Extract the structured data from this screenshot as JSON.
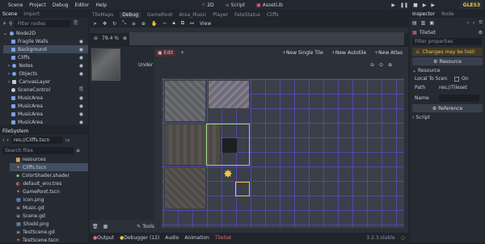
{
  "menu": [
    "Scene",
    "Project",
    "Debug",
    "Editor",
    "Help"
  ],
  "workspaces": [
    "2D",
    "Script",
    "AssetLib"
  ],
  "renderer": "GLES3",
  "scene_panel": {
    "tabs": [
      "Scene",
      "Import"
    ],
    "filter_placeholder": "Filter nodes",
    "nodes": [
      "Node2D",
      "Fragile Walls",
      "Background",
      "Cliffs",
      "Notes",
      "Objects",
      "CanvasLayer",
      "SceneControl",
      "MusicArea",
      "MusicArea",
      "MusicArea",
      "MusicArea"
    ]
  },
  "filesystem": {
    "title": "FileSystem",
    "path": "res://Cliffs.tscn",
    "search_placeholder": "Search files",
    "files": [
      "resources",
      "Cliffs.tscn",
      "ColorShader.shader",
      "default_env.tres",
      "GameRoot.tscn",
      "icon.png",
      "Music.gd",
      "Scene.gd",
      "Shield.png",
      "TestScene.gd",
      "TestScene.tscn"
    ]
  },
  "editor_tabs": [
    "TileMaps",
    "Debug",
    "GameRoot",
    "Area_Music",
    "Player",
    "FateStatus",
    "Cliffs"
  ],
  "zoom": "79.4 %",
  "tileset_toolbar": {
    "edit": "Edit",
    "new_single": "New Single Tile",
    "new_autotile": "New Autotile",
    "new_atlas": "New Atlas"
  },
  "under_label": "Under",
  "bottom_tabs": [
    "Output",
    "Debugger (12)",
    "Audio",
    "Animation",
    "TileSet"
  ],
  "version": "3.2.3.stable",
  "tools_label": "Tools",
  "inspector": {
    "tabs": [
      "Inspector",
      "Node"
    ],
    "resource": "TileSet",
    "filter_placeholder": "Filter properties",
    "warning": "Changes may be lost!",
    "resource_btn": "Resource",
    "section_resource": "Resource",
    "local_to_scene": "Local To Scen",
    "on": "On",
    "path_label": "Path",
    "path_value": "res://Tileset",
    "name_label": "Name",
    "reference": "Reference",
    "script": "Script"
  }
}
